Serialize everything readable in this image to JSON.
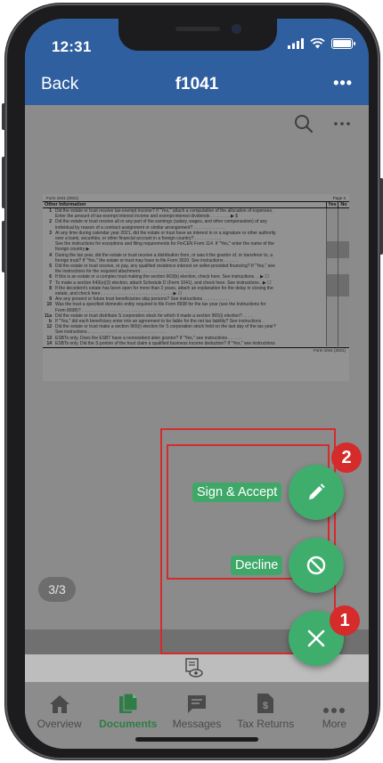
{
  "status_bar": {
    "time": "12:31"
  },
  "header": {
    "back_label": "Back",
    "title": "f1041",
    "more_label": "•••"
  },
  "viewer": {
    "search_icon": "search-icon",
    "more_icon": "more-horizontal-icon",
    "page_indicator": "3/3"
  },
  "document": {
    "form_label": "Form 1041 (2021)",
    "page_label": "Page 3",
    "section_title": "Other Information",
    "yes_label": "Yes",
    "no_label": "No",
    "lines": [
      {
        "num": "1",
        "text": "Did the estate or trust receive tax-exempt income? If \"Yes,\" attach a computation of the allocation of expenses.",
        "dark": false
      },
      {
        "num": "",
        "text": "Enter the amount of tax-exempt interest income and exempt-interest dividends  . . . . . . . . ▶ $",
        "dark": false
      },
      {
        "num": "2",
        "text": "Did the estate or trust receive all or any part of the earnings (salary, wages, and other compensation) of any",
        "dark": false
      },
      {
        "num": "",
        "text": "individual by reason of a contract assignment or similar arrangement?  . . . . . . . . . . . . .",
        "dark": false
      },
      {
        "num": "3",
        "text": "At any time during calendar year 2021, did the estate or trust have an interest in or a signature or other authority",
        "dark": false
      },
      {
        "num": "",
        "text": "over a bank, securities, or other financial account in a foreign country?  . . . . . . . . . . .",
        "dark": false
      },
      {
        "num": "",
        "text": "See the instructions for exceptions and filing requirements for FinCEN Form 114. If \"Yes,\" enter the name of the",
        "dark": true
      },
      {
        "num": "",
        "text": "foreign country ▶",
        "dark": true
      },
      {
        "num": "4",
        "text": "During the tax year, did the estate or trust receive a distribution from, or was it the grantor of, or transferor to, a",
        "dark": true
      },
      {
        "num": "",
        "text": "foreign trust? If \"Yes,\" the estate or trust may have to file Form 3520. See instructions  . . . . . .",
        "dark": false
      },
      {
        "num": "5",
        "text": "Did the estate or trust receive, or pay, any qualified residence interest on seller-provided financing? If \"Yes,\" see",
        "dark": false
      },
      {
        "num": "",
        "text": "the instructions for the required attachment  . . . . . . . . . . . . . . . . . . . . . . .",
        "dark": false
      },
      {
        "num": "6",
        "text": "If this is an estate or a complex trust making the section 663(b) election, check here. See instructions  . . ▶ ☐",
        "dark": true
      },
      {
        "num": "7",
        "text": "To make a section 643(e)(3) election, attach Schedule D (Form 1041), and check here. See instructions  . ▶ ☐",
        "dark": true
      },
      {
        "num": "8",
        "text": "If the decedent's estate has been open for more than 2 years, attach an explanation for the delay in closing the",
        "dark": true
      },
      {
        "num": "",
        "text": "estate, and check here  . . . . . . . . . . . . . . . . . . . . . . . . . . . . . ▶ ☐",
        "dark": true
      },
      {
        "num": "9",
        "text": "Are any present or future trust beneficiaries skip persons? See instructions  . . . . . . . . . . .",
        "dark": false
      },
      {
        "num": "10",
        "text": "Was the trust a specified domestic entity required to file Form 8938 for the tax year (see the Instructions for",
        "dark": false
      },
      {
        "num": "",
        "text": "Form 8938)?  . . . . . . . . . . . . . . . . . . . . . . . . . . . . . . . . .",
        "dark": false
      },
      {
        "num": "11a",
        "text": "Did the estate or trust distribute S corporation stock for which it made a section 965(i) election?  . . . .",
        "dark": false
      },
      {
        "num": "b",
        "text": "If \"Yes,\" did each beneficiary enter into an agreement to be liable for the net tax liability? See instructions  .",
        "dark": false
      },
      {
        "num": "12",
        "text": "Did the estate or trust make a section 965(i) election for S corporation stock held on the last day of the tax year?",
        "dark": false
      },
      {
        "num": "",
        "text": "See instructions  . . . . . . . . . . . . . . . . . . . . . . . . . . . . . . . .",
        "dark": false
      },
      {
        "num": "13",
        "text": "ESBTs only. Does the ESBT have a nonresident alien grantor? If \"Yes,\" see instructions  . . . . . .",
        "dark": false
      },
      {
        "num": "14",
        "text": "ESBTs only. Did the S portion of the trust claim a qualified business income deduction? If \"Yes,\" see instructions",
        "dark": false
      }
    ],
    "footer": "Form 1041 (2021)"
  },
  "actions": {
    "sign_accept_label": "Sign & Accept",
    "decline_label": "Decline",
    "marker_1": "1",
    "marker_2": "2",
    "accent_color": "#3fae6c",
    "highlight_color": "#d62b2b"
  },
  "tabbar": {
    "tabs": [
      {
        "label": "Overview",
        "icon": "home-icon",
        "active": false
      },
      {
        "label": "Documents",
        "icon": "documents-icon",
        "active": true
      },
      {
        "label": "Messages",
        "icon": "message-icon",
        "active": false
      },
      {
        "label": "Tax Returns",
        "icon": "tax-return-icon",
        "active": false
      },
      {
        "label": "More",
        "icon": "more-horizontal-icon",
        "active": false
      }
    ]
  },
  "colors": {
    "header": "#2f5f9e",
    "active_tab": "#2e7d45"
  }
}
